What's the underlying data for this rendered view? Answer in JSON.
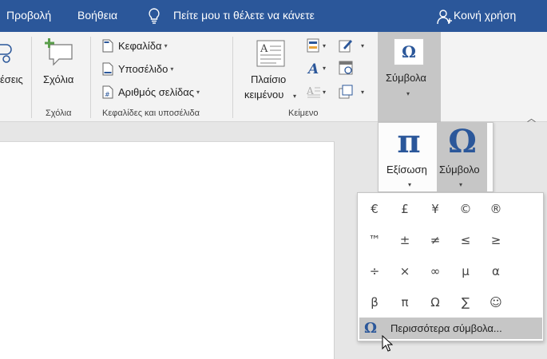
{
  "tabs": [
    {
      "label": "Προβολή"
    },
    {
      "label": "Βοήθεια"
    }
  ],
  "tell_me": "Πείτε μου τι θέλετε να κάνετε",
  "share": "Κοινή χρήση",
  "ribbon": {
    "partial_left": "έσεις",
    "comments": {
      "button": "Σχόλια",
      "group": "Σχόλια"
    },
    "header_footer": {
      "items": [
        {
          "label": "Κεφαλίδα"
        },
        {
          "label": "Υποσέλιδο"
        },
        {
          "label": "Αριθμός σελίδας"
        }
      ],
      "group": "Κεφαλίδες και υποσέλιδα"
    },
    "text": {
      "textbox_line1": "Πλαίσιο",
      "textbox_line2": "κειμένου",
      "group": "Κείμενο"
    },
    "symbols": {
      "button": "Σύμβολα",
      "icon_glyph": "Ω"
    }
  },
  "symbols_menu": {
    "equation": {
      "glyph": "π",
      "label": "Εξίσωση"
    },
    "symbol": {
      "glyph": "Ω",
      "label": "Σύμβολο"
    }
  },
  "gallery": {
    "symbols": [
      "€",
      "£",
      "¥",
      "©",
      "®",
      "™",
      "±",
      "≠",
      "≤",
      "≥",
      "÷",
      "×",
      "∞",
      "µ",
      "α",
      "β",
      "π",
      "Ω",
      "∑",
      "☺"
    ],
    "more_icon": "Ω",
    "more_label": "Περισσότερα σύμβολα..."
  },
  "colors": {
    "accent": "#2b579a",
    "highlight": "#c6c6c6"
  }
}
